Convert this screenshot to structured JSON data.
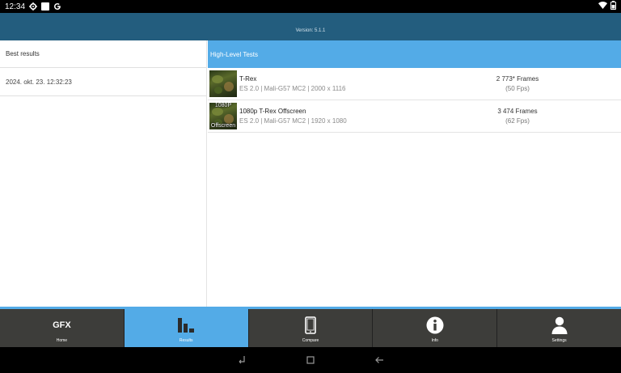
{
  "statusbar": {
    "time": "12:34",
    "icons": [
      "settings-icon",
      "square-icon",
      "google-icon"
    ],
    "right_icons": [
      "wifi-icon",
      "battery-icon"
    ]
  },
  "header": {
    "version": "Version: 5.1.1"
  },
  "left_panel": {
    "title": "Best results",
    "rows": [
      "2024. okt. 23. 12:32:23"
    ]
  },
  "right_panel": {
    "title": "High-Level Tests",
    "tests": [
      {
        "name": "T-Rex",
        "details": "ES 2.0 | Mali-G57 MC2 | 2000 x 1116",
        "score": "2 773* Frames",
        "fps": "(50 Fps)",
        "thumb_top": "",
        "thumb_bottom": ""
      },
      {
        "name": "1080p T-Rex Offscreen",
        "details": "ES 2.0 | Mali-G57 MC2 | 1920 x 1080",
        "score": "3 474 Frames",
        "fps": "(62 Fps)",
        "thumb_top": "1080P",
        "thumb_bottom": "Offscreen"
      }
    ]
  },
  "nav": {
    "items": [
      {
        "label": "Home",
        "icon": "gfx-logo-icon",
        "logo_text": "GFX"
      },
      {
        "label": "Results",
        "icon": "bar-chart-icon"
      },
      {
        "label": "Compare",
        "icon": "phone-icon"
      },
      {
        "label": "Info",
        "icon": "info-icon"
      },
      {
        "label": "Settings",
        "icon": "person-icon"
      }
    ],
    "active": "Results"
  },
  "colors": {
    "header": "#235d7e",
    "accent": "#53abe7",
    "nav": "#3d3d3a"
  }
}
